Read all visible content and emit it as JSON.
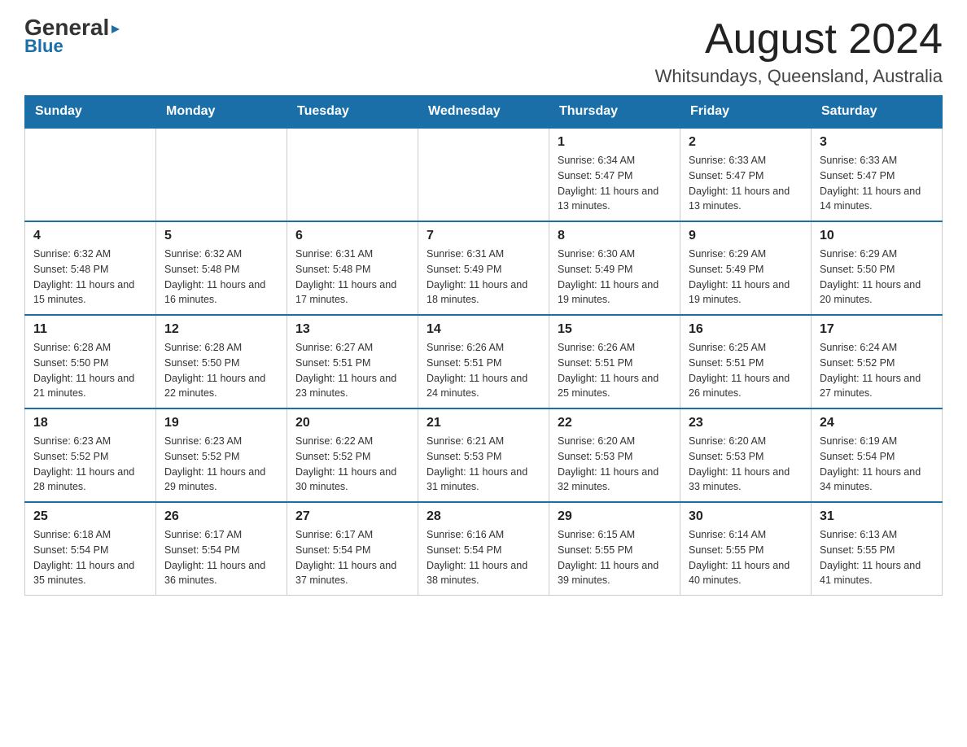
{
  "logo": {
    "general": "General",
    "arrow_char": "▶",
    "blue": "Blue"
  },
  "title": "August 2024",
  "subtitle": "Whitsundays, Queensland, Australia",
  "days_of_week": [
    "Sunday",
    "Monday",
    "Tuesday",
    "Wednesday",
    "Thursday",
    "Friday",
    "Saturday"
  ],
  "weeks": [
    {
      "cells": [
        {
          "day": "",
          "info": ""
        },
        {
          "day": "",
          "info": ""
        },
        {
          "day": "",
          "info": ""
        },
        {
          "day": "",
          "info": ""
        },
        {
          "day": "1",
          "info": "Sunrise: 6:34 AM\nSunset: 5:47 PM\nDaylight: 11 hours and 13 minutes."
        },
        {
          "day": "2",
          "info": "Sunrise: 6:33 AM\nSunset: 5:47 PM\nDaylight: 11 hours and 13 minutes."
        },
        {
          "day": "3",
          "info": "Sunrise: 6:33 AM\nSunset: 5:47 PM\nDaylight: 11 hours and 14 minutes."
        }
      ]
    },
    {
      "cells": [
        {
          "day": "4",
          "info": "Sunrise: 6:32 AM\nSunset: 5:48 PM\nDaylight: 11 hours and 15 minutes."
        },
        {
          "day": "5",
          "info": "Sunrise: 6:32 AM\nSunset: 5:48 PM\nDaylight: 11 hours and 16 minutes."
        },
        {
          "day": "6",
          "info": "Sunrise: 6:31 AM\nSunset: 5:48 PM\nDaylight: 11 hours and 17 minutes."
        },
        {
          "day": "7",
          "info": "Sunrise: 6:31 AM\nSunset: 5:49 PM\nDaylight: 11 hours and 18 minutes."
        },
        {
          "day": "8",
          "info": "Sunrise: 6:30 AM\nSunset: 5:49 PM\nDaylight: 11 hours and 19 minutes."
        },
        {
          "day": "9",
          "info": "Sunrise: 6:29 AM\nSunset: 5:49 PM\nDaylight: 11 hours and 19 minutes."
        },
        {
          "day": "10",
          "info": "Sunrise: 6:29 AM\nSunset: 5:50 PM\nDaylight: 11 hours and 20 minutes."
        }
      ]
    },
    {
      "cells": [
        {
          "day": "11",
          "info": "Sunrise: 6:28 AM\nSunset: 5:50 PM\nDaylight: 11 hours and 21 minutes."
        },
        {
          "day": "12",
          "info": "Sunrise: 6:28 AM\nSunset: 5:50 PM\nDaylight: 11 hours and 22 minutes."
        },
        {
          "day": "13",
          "info": "Sunrise: 6:27 AM\nSunset: 5:51 PM\nDaylight: 11 hours and 23 minutes."
        },
        {
          "day": "14",
          "info": "Sunrise: 6:26 AM\nSunset: 5:51 PM\nDaylight: 11 hours and 24 minutes."
        },
        {
          "day": "15",
          "info": "Sunrise: 6:26 AM\nSunset: 5:51 PM\nDaylight: 11 hours and 25 minutes."
        },
        {
          "day": "16",
          "info": "Sunrise: 6:25 AM\nSunset: 5:51 PM\nDaylight: 11 hours and 26 minutes."
        },
        {
          "day": "17",
          "info": "Sunrise: 6:24 AM\nSunset: 5:52 PM\nDaylight: 11 hours and 27 minutes."
        }
      ]
    },
    {
      "cells": [
        {
          "day": "18",
          "info": "Sunrise: 6:23 AM\nSunset: 5:52 PM\nDaylight: 11 hours and 28 minutes."
        },
        {
          "day": "19",
          "info": "Sunrise: 6:23 AM\nSunset: 5:52 PM\nDaylight: 11 hours and 29 minutes."
        },
        {
          "day": "20",
          "info": "Sunrise: 6:22 AM\nSunset: 5:52 PM\nDaylight: 11 hours and 30 minutes."
        },
        {
          "day": "21",
          "info": "Sunrise: 6:21 AM\nSunset: 5:53 PM\nDaylight: 11 hours and 31 minutes."
        },
        {
          "day": "22",
          "info": "Sunrise: 6:20 AM\nSunset: 5:53 PM\nDaylight: 11 hours and 32 minutes."
        },
        {
          "day": "23",
          "info": "Sunrise: 6:20 AM\nSunset: 5:53 PM\nDaylight: 11 hours and 33 minutes."
        },
        {
          "day": "24",
          "info": "Sunrise: 6:19 AM\nSunset: 5:54 PM\nDaylight: 11 hours and 34 minutes."
        }
      ]
    },
    {
      "cells": [
        {
          "day": "25",
          "info": "Sunrise: 6:18 AM\nSunset: 5:54 PM\nDaylight: 11 hours and 35 minutes."
        },
        {
          "day": "26",
          "info": "Sunrise: 6:17 AM\nSunset: 5:54 PM\nDaylight: 11 hours and 36 minutes."
        },
        {
          "day": "27",
          "info": "Sunrise: 6:17 AM\nSunset: 5:54 PM\nDaylight: 11 hours and 37 minutes."
        },
        {
          "day": "28",
          "info": "Sunrise: 6:16 AM\nSunset: 5:54 PM\nDaylight: 11 hours and 38 minutes."
        },
        {
          "day": "29",
          "info": "Sunrise: 6:15 AM\nSunset: 5:55 PM\nDaylight: 11 hours and 39 minutes."
        },
        {
          "day": "30",
          "info": "Sunrise: 6:14 AM\nSunset: 5:55 PM\nDaylight: 11 hours and 40 minutes."
        },
        {
          "day": "31",
          "info": "Sunrise: 6:13 AM\nSunset: 5:55 PM\nDaylight: 11 hours and 41 minutes."
        }
      ]
    }
  ]
}
